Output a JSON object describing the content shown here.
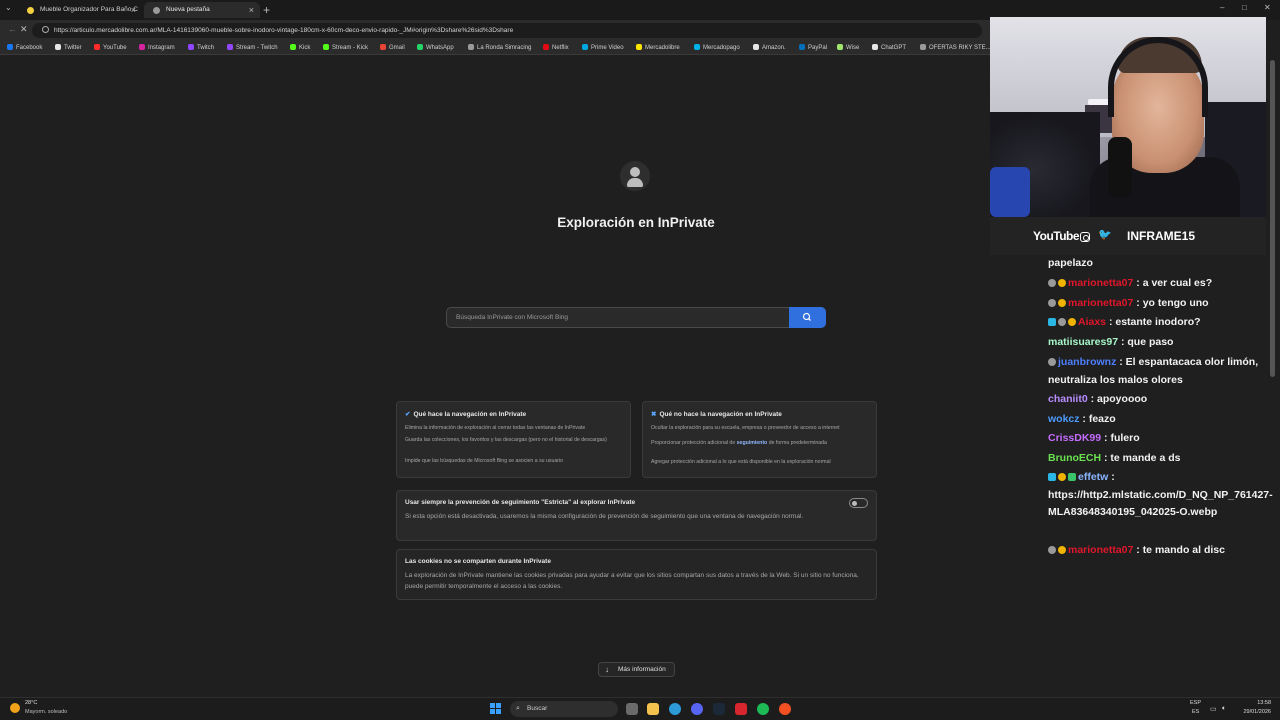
{
  "browser": {
    "tabs": [
      {
        "label": "Mueble Organizador Para Baño C",
        "active": false,
        "favicon_color": "#f5d142"
      },
      {
        "label": "Nueva pestaña",
        "active": true,
        "favicon_color": "#9a9a9a"
      }
    ],
    "new_tab_symbol": "+",
    "close_symbol": "×",
    "url": "https://articulo.mercadolibre.com.ar/MLA-1416139060-mueble-sobre-inodoro-vintage-180cm-x-60cm-deco-envio-rapido-_JM#origin%3Dshare%26sid%3Dshare",
    "bookmarks": [
      {
        "label": "Facebook",
        "color": "#1877f2"
      },
      {
        "label": "Twitter",
        "color": "#e6e6e6"
      },
      {
        "label": "YouTube",
        "color": "#ff2b2b"
      },
      {
        "label": "Instagram",
        "color": "#d6249f"
      },
      {
        "label": "Twitch",
        "color": "#9146ff"
      },
      {
        "label": "Stream - Twitch",
        "color": "#9146ff"
      },
      {
        "label": "Kick",
        "color": "#53fc18"
      },
      {
        "label": "Stream - Kick",
        "color": "#53fc18"
      },
      {
        "label": "Gmail",
        "color": "#ea4335"
      },
      {
        "label": "WhatsApp",
        "color": "#25d366"
      },
      {
        "label": "La Ronda Simracing",
        "color": "#9a9a9a"
      },
      {
        "label": "Netflix",
        "color": "#e50914"
      },
      {
        "label": "Prime Video",
        "color": "#00a8e1"
      },
      {
        "label": "Mercadolibre",
        "color": "#ffe600"
      },
      {
        "label": "Mercadopago",
        "color": "#00b1ea"
      },
      {
        "label": "Amazon.",
        "color": "#e6e6e6"
      },
      {
        "label": "PayPal",
        "color": "#0070ba"
      },
      {
        "label": "Wise",
        "color": "#9fe870"
      },
      {
        "label": "ChatGPT",
        "color": "#e6e6e6"
      },
      {
        "label": "OFERTAS RIKY STE...",
        "color": "#9a9a9a"
      }
    ]
  },
  "inprivate": {
    "title": "Exploración en InPrivate",
    "search_placeholder": "Búsqueda InPrivate con Microsoft Bing",
    "does": {
      "title": "Qué hace la navegación en InPrivate",
      "items": [
        "Elimina la información de exploración al cerrar todas las ventanas de InPrivate",
        "Guarda las colecciones, los favoritos y las descargas (pero no el historial de descargas)",
        "Impide que las búsquedas de Microsoft Bing se asocien a su usuario"
      ]
    },
    "doesnt": {
      "title": "Qué no hace la navegación en InPrivate",
      "items": [
        "Ocultar la exploración para su escuela, empresa o proveedor de acceso a internet",
        "Proporcionar protección adicional de",
        "seguimiento",
        "de forma predeterminada",
        "Agregar protección adicional a lo que está disponible en la exploración normal"
      ]
    },
    "strict": {
      "title": "Usar siempre la prevención de seguimiento \"Estricta\" al explorar InPrivate",
      "body": "Si esta opción está desactivada, usaremos la misma configuración de prevención de seguimiento que una ventana de navegación normal.",
      "enabled": false
    },
    "cookies": {
      "title": "Las cookies no se comparten durante InPrivate",
      "body": "La exploración de InPrivate mantiene las cookies privadas para ayudar a evitar que los sitios compartan sus datos a través de la Web. Si un sitio no funciona, puede permitir temporalmente el acceso a las cookies."
    },
    "more_info": "Más información"
  },
  "stream": {
    "youtube_logo": "YouTube",
    "handle": "INFRAME15",
    "chat": [
      {
        "user": "",
        "text": "papelazo",
        "color": "#f2f2f2",
        "badges": []
      },
      {
        "user": "marionetta07",
        "text": " : a ver cual es?",
        "color": "#e0162b",
        "badges": [
          "grey",
          "gold"
        ]
      },
      {
        "user": "marionetta07",
        "text": " : yo tengo uno",
        "color": "#e0162b",
        "badges": [
          "grey",
          "gold"
        ]
      },
      {
        "user": "Aiaxs",
        "text": " : estante inodoro?",
        "color": "#e0162b",
        "badges": [
          "cyan",
          "grey",
          "gold"
        ]
      },
      {
        "user": "matiisuares97",
        "text": " : que paso",
        "color": "#a6f5c8",
        "badges": []
      },
      {
        "user": "juanbrownz",
        "text": " : El espantacaca olor limón, neutraliza los malos olores",
        "color": "#4d7fff",
        "badges": [
          "grey"
        ]
      },
      {
        "user": "chaniit0",
        "text": " : apoyoooo",
        "color": "#b98cff",
        "badges": []
      },
      {
        "user": "wokcz",
        "text": " : feazo",
        "color": "#4d9bff",
        "badges": []
      },
      {
        "user": "CrissDK99",
        "text": " : fulero",
        "color": "#c56cff",
        "badges": []
      },
      {
        "user": "BrunoECH",
        "text": " : te mande a ds",
        "color": "#69e34f",
        "badges": []
      },
      {
        "user": "effetw",
        "text": " : https://http2.mlstatic.com/D_NQ_NP_761427-MLA83648340195_042025-O.webp",
        "color": "#8ab4ff",
        "badges": [
          "cyan",
          "gold",
          "green"
        ]
      },
      {
        "user": "marionetta07",
        "text": " : te mando al disc",
        "color": "#e0162b",
        "badges": [
          "grey",
          "gold"
        ]
      }
    ]
  },
  "taskbar": {
    "temperature": "28°C",
    "weather": "Mayorm. soleado",
    "search_label": "Buscar",
    "lang_top": "ESP",
    "lang_bottom": "ES",
    "time": "13:58",
    "date": "29/01/2026"
  }
}
